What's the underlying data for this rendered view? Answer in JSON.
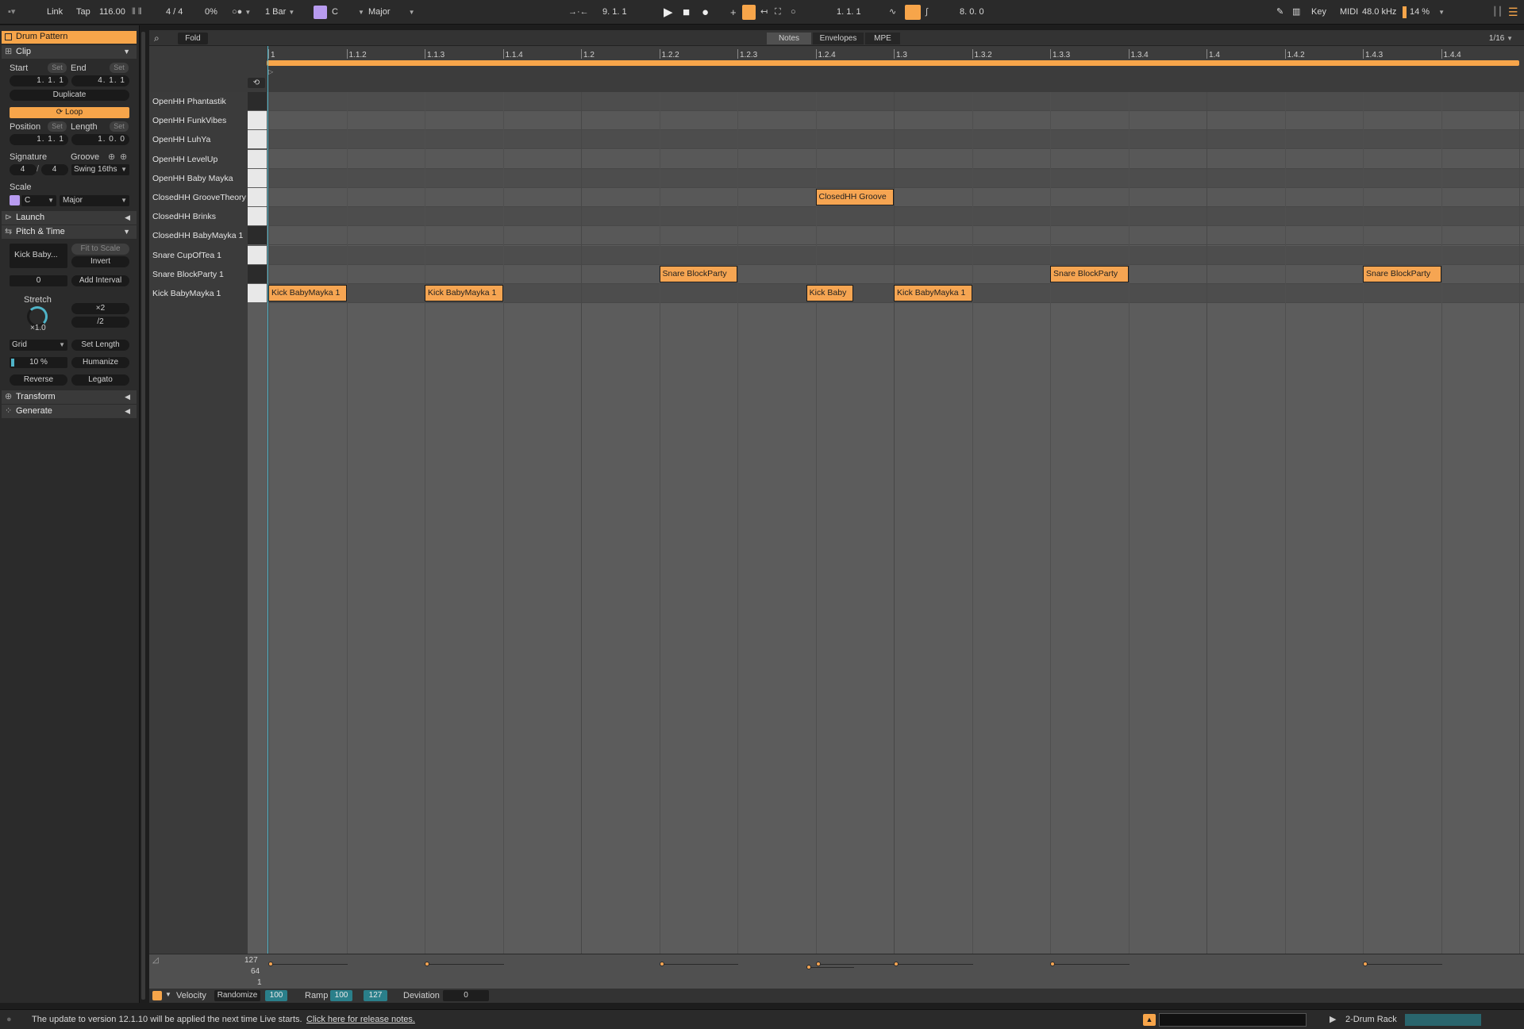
{
  "transport": {
    "link_label": "Link",
    "tap_label": "Tap",
    "tempo": "116.00",
    "time_signature": "4 / 4",
    "swing_amount": "0%",
    "quantize": "1 Bar",
    "key": "C",
    "scale_mode": "Major",
    "arrangement_position": "9.   1.   1",
    "loop_start": "1.   1.   1",
    "loop_length": "8.   0.   0",
    "key_label": "Key",
    "midi_label": "MIDI",
    "sample_rate": "48.0 kHz",
    "cpu_load": "14 %"
  },
  "clip_panel": {
    "clip_name": "Drum Pattern",
    "section_clip": "Clip",
    "start_label": "Start",
    "end_label": "End",
    "set_label": "Set",
    "start_value": "1.   1.   1",
    "end_value": "4.   1.   1",
    "duplicate_label": "Duplicate",
    "loop_label": "Loop",
    "position_label": "Position",
    "length_label": "Length",
    "position_value": "1.   1.   1",
    "length_value": "1.   0.   0",
    "signature_label": "Signature",
    "groove_label": "Groove",
    "sig_numerator": "4",
    "sig_denominator": "4",
    "groove_value": "Swing 16ths",
    "scale_label": "Scale",
    "scale_root": "C",
    "scale_mode": "Major",
    "section_launch": "Launch",
    "section_pitch_time": "Pitch & Time",
    "selected_note_preview": "Kick Baby...",
    "fit_to_scale": "Fit to Scale",
    "invert": "Invert",
    "interval_value": "0",
    "add_interval": "Add Interval",
    "stretch_label": "Stretch",
    "stretch_value": "×1.0",
    "times_two": "×2",
    "divide_two": "/2",
    "grid_mode": "Grid",
    "set_length": "Set Length",
    "humanize_amount": "10 %",
    "humanize": "Humanize",
    "reverse": "Reverse",
    "legato": "Legato",
    "section_transform": "Transform",
    "section_generate": "Generate"
  },
  "editor": {
    "fold_label": "Fold",
    "tabs": [
      "Notes",
      "Envelopes",
      "MPE"
    ],
    "grid_resolution": "1/16",
    "ruler": [
      "1",
      "1.1.2",
      "1.1.3",
      "1.1.4",
      "1.2",
      "1.2.2",
      "1.2.3",
      "1.2.4",
      "1.3",
      "1.3.2",
      "1.3.3",
      "1.3.4",
      "1.4",
      "1.4.2",
      "1.4.3",
      "1.4.4"
    ],
    "lanes": [
      "OpenHH Phantastik",
      "OpenHH FunkVibes",
      "OpenHH LuhYa",
      "OpenHH LevelUp",
      "OpenHH Baby Mayka",
      "ClosedHH GrooveTheory",
      "ClosedHH Brinks",
      "ClosedHH BabyMayka 1",
      "Snare CupOfTea 1",
      "Snare BlockParty 1",
      "Kick BabyMayka 1"
    ],
    "notes": [
      {
        "label": "ClosedHH Groove",
        "lane": 5,
        "start": 1.75,
        "length": 0.25,
        "velocity": 100
      },
      {
        "label": "Snare BlockParty",
        "lane": 9,
        "start": 1.25,
        "length": 0.25,
        "velocity": 100
      },
      {
        "label": "Snare BlockParty",
        "lane": 9,
        "start": 2.5,
        "length": 0.25,
        "velocity": 100
      },
      {
        "label": "Snare BlockParty",
        "lane": 9,
        "start": 3.5,
        "length": 0.25,
        "velocity": 100
      },
      {
        "label": "Kick BabyMayka 1",
        "lane": 10,
        "start": 0.0,
        "length": 0.25,
        "velocity": 100
      },
      {
        "label": "Kick BabyMayka 1",
        "lane": 10,
        "start": 0.5,
        "length": 0.25,
        "velocity": 100
      },
      {
        "label": "Kick Baby",
        "lane": 10,
        "start": 1.72,
        "length": 0.15,
        "velocity": 85
      },
      {
        "label": "Kick BabyMayka 1",
        "lane": 10,
        "start": 2.0,
        "length": 0.25,
        "velocity": 100
      }
    ],
    "velocity_scale": [
      "127",
      "64",
      "1"
    ],
    "velocity_label": "Velocity",
    "randomize_label": "Randomize",
    "randomize_value": "100",
    "ramp_label": "Ramp",
    "ramp_start": "100",
    "ramp_end": "127",
    "deviation_label": "Deviation",
    "deviation_value": "0"
  },
  "status": {
    "message": "The update to version 12.1.10 will be applied the next time Live starts.",
    "link": "Click here for release notes.",
    "track_name": "2-Drum Rack"
  },
  "colors": {
    "accent": "#f7a54a",
    "note_fill": "#f6a552",
    "scale_purple": "#b89bf0",
    "field_teal": "#2a7f8a"
  }
}
